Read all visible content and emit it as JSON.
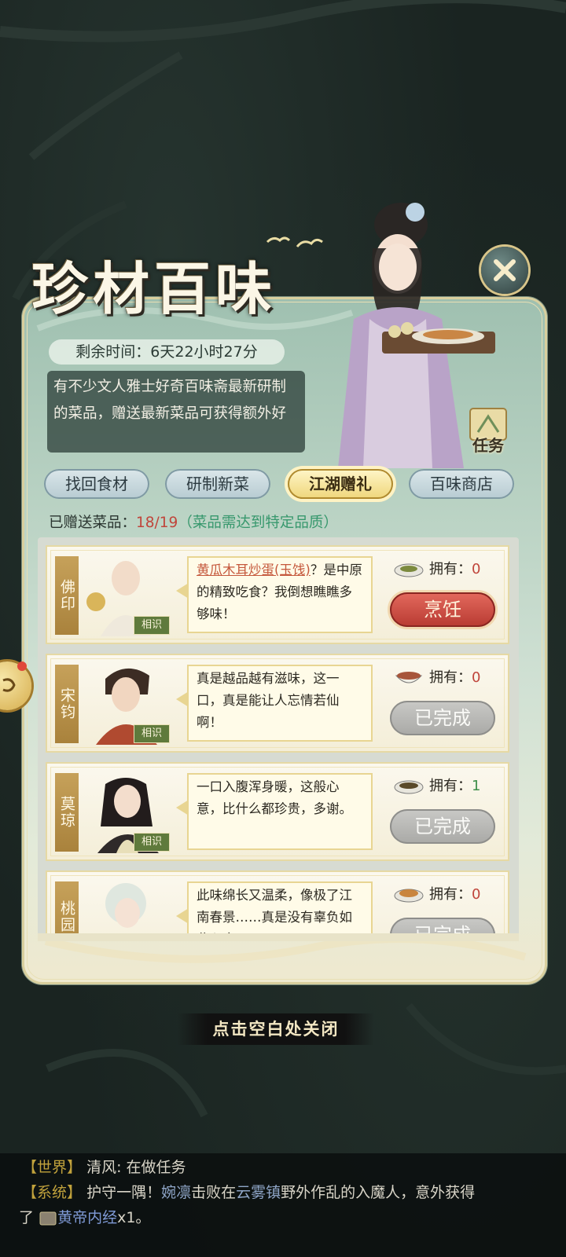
{
  "title": "珍材百味",
  "timer": "剩余时间：6天22小时27分",
  "description": "有不少文人雅士好奇百味斋最新研制的菜品，赠送最新菜品可获得额外好",
  "task_label": "任务",
  "tabs": [
    {
      "label": "找回食材",
      "active": false
    },
    {
      "label": "研制新菜",
      "active": false
    },
    {
      "label": "江湖赠礼",
      "active": true
    },
    {
      "label": "百味商店",
      "active": false
    }
  ],
  "gift": {
    "label": "已赠送菜品：",
    "count": "18/19",
    "note": "（菜品需达到特定品质）"
  },
  "cards": [
    {
      "name": "佛印",
      "badge": "相识",
      "dish": "黄瓜木耳炒蛋(玉饯)",
      "speech": "？是中原的精致吃食？我倒想瞧瞧多够味！",
      "have_label": "拥有：",
      "have_count": "0",
      "button": "烹饪",
      "state": "cook"
    },
    {
      "name": "宋钧",
      "badge": "相识",
      "dish": "",
      "speech": "真是越品越有滋味，这一口，真是能让人忘情若仙啊！",
      "have_label": "拥有：",
      "have_count": "0",
      "button": "已完成",
      "state": "done"
    },
    {
      "name": "莫琼",
      "badge": "相识",
      "dish": "",
      "speech": "一口入腹浑身暖，这般心意，比什么都珍贵，多谢。",
      "have_label": "拥有：",
      "have_count": "1",
      "button": "已完成",
      "state": "done"
    },
    {
      "name": "桃园童",
      "badge": "",
      "dish": "",
      "speech": "此味绵长又温柔，像极了江南春景……真是没有辜负如此心意",
      "have_label": "拥有：",
      "have_count": "0",
      "button": "已完成",
      "state": "done"
    }
  ],
  "close_hint": "点击空白处关闭",
  "chat": {
    "line1_tag": "【世界】",
    "line1_text": "清风: 在做任务",
    "line2_tag": "【系统】",
    "line2_pre": "护守一隅！",
    "line2_name": "婉凛",
    "line2_mid": "击败在",
    "line2_place": "云雾镇",
    "line2_post": "野外作乱的入魔人，意外获得",
    "line3_pre": "了",
    "line3_item": "黄帝内经",
    "line3_post": "x1。"
  },
  "colors": {
    "accent_red": "#c0453b",
    "accent_green": "#37986d",
    "panel_gold": "#d9cf9e"
  }
}
